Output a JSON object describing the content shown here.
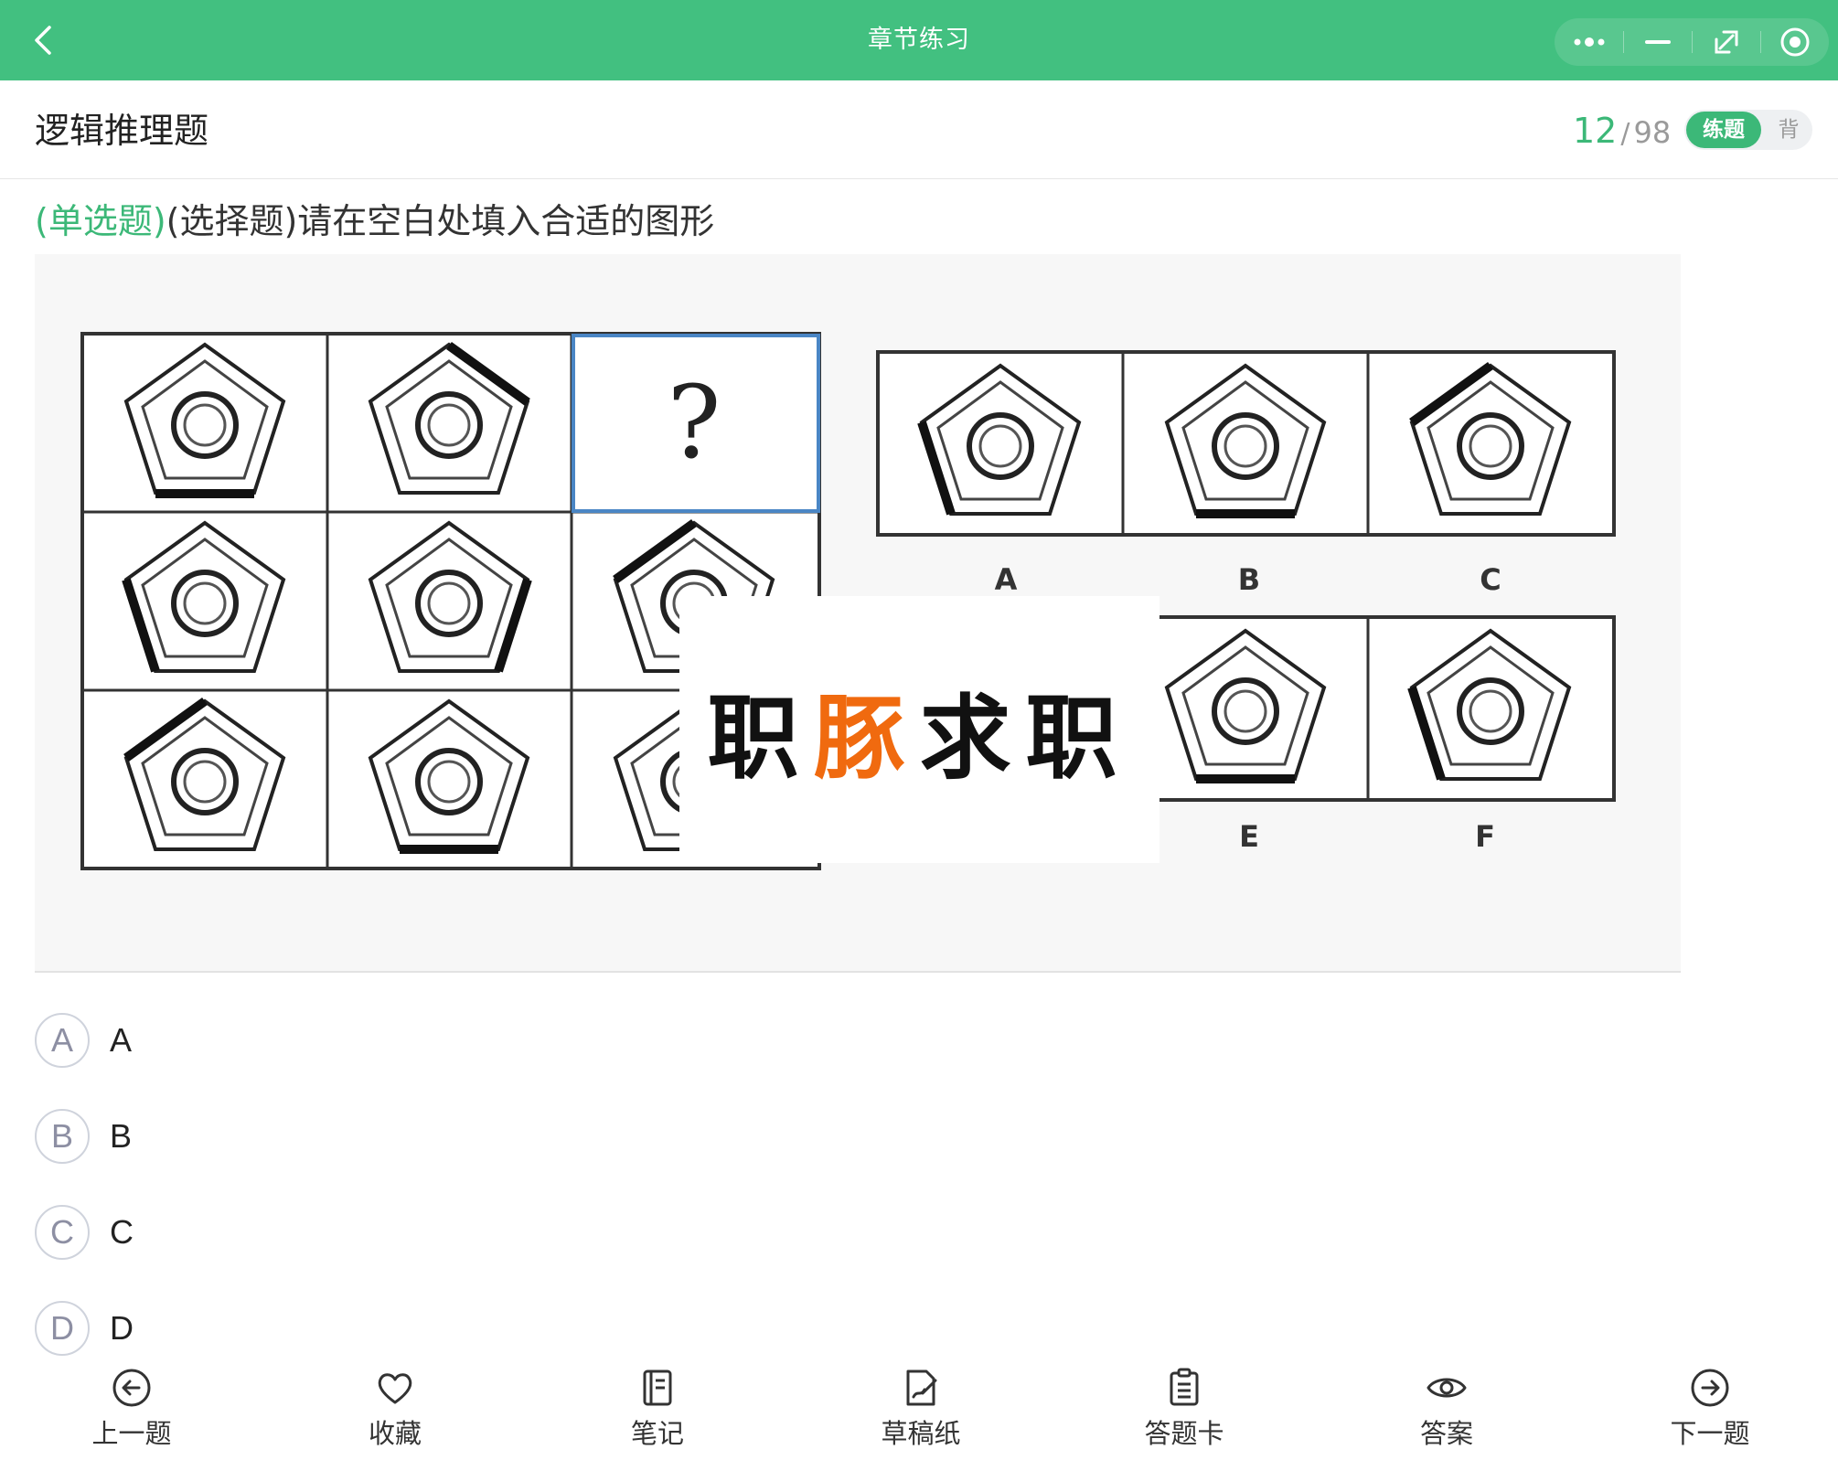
{
  "topbar": {
    "title": "章节练习",
    "capsule": [
      "more-icon",
      "minimize-icon",
      "restore-icon",
      "close-circle-icon"
    ],
    "bg_color": "#42c080"
  },
  "header": {
    "chapter_title": "逻辑推理题",
    "current": "12",
    "separator": "/",
    "total": "98",
    "mode_on": "练题",
    "mode_off": "背"
  },
  "question": {
    "type_label": "(单选题)",
    "text": "(选择题)请在空白处填入合适的图形"
  },
  "figure": {
    "question_mark": "?",
    "answer_labels": [
      "A",
      "B",
      "C",
      "E",
      "F"
    ],
    "watermark_a": "职",
    "watermark_b": "豚",
    "watermark_c": "求职"
  },
  "options": [
    {
      "letter": "A",
      "label": "A"
    },
    {
      "letter": "B",
      "label": "B"
    },
    {
      "letter": "C",
      "label": "C"
    },
    {
      "letter": "D",
      "label": "D"
    }
  ],
  "bottom_nav": [
    {
      "label": "上一题",
      "icon": "arrow-left-circle-icon"
    },
    {
      "label": "收藏",
      "icon": "heart-icon"
    },
    {
      "label": "笔记",
      "icon": "notebook-icon"
    },
    {
      "label": "草稿纸",
      "icon": "draft-paper-icon"
    },
    {
      "label": "答题卡",
      "icon": "answer-card-icon"
    },
    {
      "label": "答案",
      "icon": "eye-icon"
    },
    {
      "label": "下一题",
      "icon": "arrow-right-circle-icon"
    }
  ],
  "accent_color": "#3cb878",
  "watermark_accent": "#f06a0f"
}
